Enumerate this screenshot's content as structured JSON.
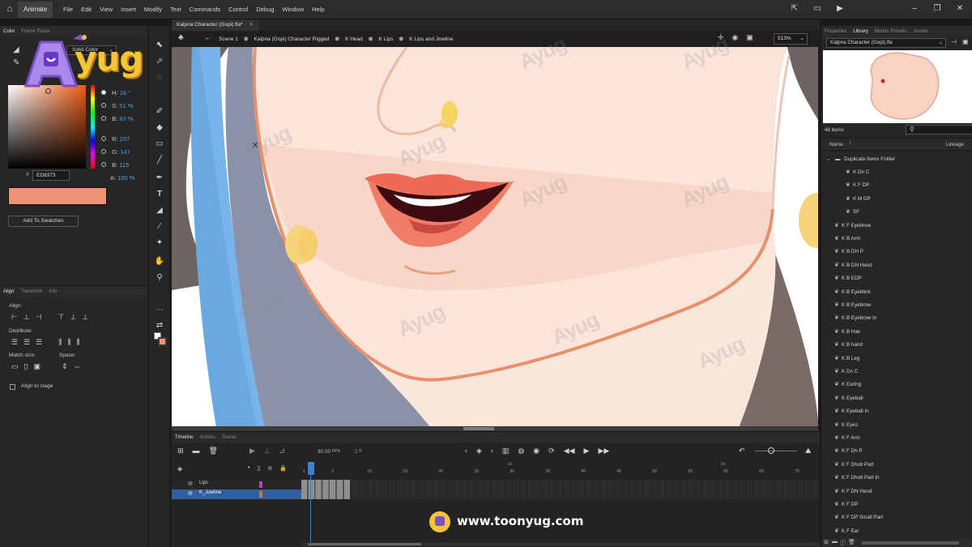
{
  "menubar": {
    "app_name": "Animate",
    "menus": [
      "File",
      "Edit",
      "View",
      "Insert",
      "Modify",
      "Text",
      "Commands",
      "Control",
      "Debug",
      "Window",
      "Help"
    ],
    "icons": [
      "home-icon",
      "share-icon",
      "window-icon",
      "play-icon",
      "window-restore-icon",
      "minimize-icon"
    ]
  },
  "color_panel": {
    "tabs": [
      "Color",
      "Frame Picker"
    ],
    "fill_type": "Solid Color",
    "h_label": "H:",
    "h_value": "16 °",
    "s_label": "S:",
    "s_value": "51 %",
    "b_label": "B:",
    "b_value": "93 %",
    "r_label": "R:",
    "r_value": "237",
    "g_label": "G:",
    "g_value": "147",
    "bb_label": "B:",
    "bb_value": "115",
    "a_label": "A:",
    "a_value": "100 %",
    "hex_prefix": "#",
    "hex_value": "ED9373",
    "swatch_color": "#ED9373",
    "add_to_swatches": "Add To Swatches"
  },
  "align_panel": {
    "tabs": [
      "Align",
      "Transform",
      "Info"
    ],
    "align_label": "Align:",
    "distribute_label": "Distribute:",
    "match_size_label": "Match size:",
    "space_label": "Space:",
    "align_to_stage": "Align to stage"
  },
  "document": {
    "tab_title": "Kalpna Character (Gopi).fla*",
    "breadcrumb": [
      "Scene 1",
      "Kalpna (Gopi) Character Rigged",
      "K Head",
      "K Lips",
      "K Lips and Jowline"
    ],
    "zoom": "513%"
  },
  "timeline": {
    "tabs": [
      "Timeline",
      "Actions",
      "Scene"
    ],
    "fps": "30.00",
    "fps_unit": "FPS",
    "frame": "2",
    "frame_unit": "F",
    "ruler_marks": [
      "1",
      "5",
      "10",
      "15",
      "20",
      "25",
      "30",
      "35",
      "40",
      "45",
      "50",
      "55",
      "60",
      "65",
      "70"
    ],
    "seconds_marks": [
      "1s",
      "2s"
    ],
    "layers": [
      {
        "name": "Lips",
        "color": "#b040d0"
      },
      {
        "name": "K_Jowline",
        "color": "#e07020"
      }
    ]
  },
  "right_panel": {
    "tabs": [
      "Properties",
      "Library",
      "Motion Presets",
      "Assets"
    ],
    "library_file": "Kalpna Character (Gopi).fla",
    "items_count": "48 items",
    "col_name": "Name",
    "col_linkage": "Linkage",
    "folder": "Duplicate Items Folder",
    "folder_items": [
      "K Dn C",
      "K F DP",
      "K M DP",
      "SF"
    ],
    "items": [
      "K  F Eyebrow",
      "K B Arm",
      "K B DH P",
      "K B DN Hand",
      "K B EDP",
      "K B Eyeblink",
      "K B Eyebrow",
      "K B Eyebrow In",
      "K B Hair",
      "K B hand",
      "K B Leg",
      "K Dn C",
      "K Earing",
      "K Eyeball",
      "K Eyeball In",
      "K Eyes",
      "K F Arm",
      "K F Dh P",
      "K F Dhoti Part",
      "K F Dhoti Part In",
      "K F DN Hand",
      "K F DP",
      "K F DP Small Part",
      "K F Ear"
    ]
  },
  "branding": {
    "logo_text": "yug",
    "website": "www.toonyug.com"
  }
}
